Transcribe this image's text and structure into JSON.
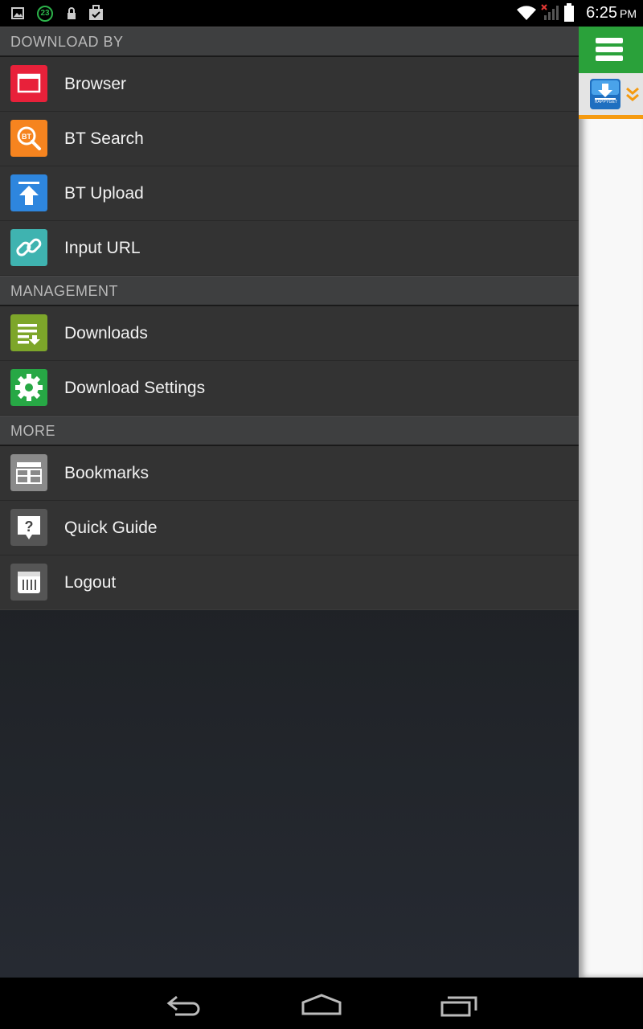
{
  "status": {
    "time": "6:25",
    "ampm": "PM",
    "notification_count": "23"
  },
  "drawer": {
    "sections": [
      {
        "title": "DOWNLOAD BY",
        "items": [
          {
            "label": "Browser",
            "icon": "browser-icon",
            "color": "#e8213a"
          },
          {
            "label": "BT Search",
            "icon": "bt-search-icon",
            "color": "#f6841f"
          },
          {
            "label": "BT Upload",
            "icon": "upload-icon",
            "color": "#2e86de"
          },
          {
            "label": "Input URL",
            "icon": "link-icon",
            "color": "#3fb3b0"
          }
        ]
      },
      {
        "title": "MANAGEMENT",
        "items": [
          {
            "label": "Downloads",
            "icon": "downloads-list-icon",
            "color": "#7da62a"
          },
          {
            "label": "Download Settings",
            "icon": "gear-icon",
            "color": "#27a845"
          }
        ]
      },
      {
        "title": "MORE",
        "items": [
          {
            "label": "Bookmarks",
            "icon": "bookmarks-icon",
            "color": "#8a8a8a"
          },
          {
            "label": "Quick Guide",
            "icon": "help-icon",
            "color": "#555555"
          },
          {
            "label": "Logout",
            "icon": "logout-icon",
            "color": "#555555"
          }
        ]
      }
    ]
  },
  "app": {
    "logo_text": "HAPPYGET"
  }
}
